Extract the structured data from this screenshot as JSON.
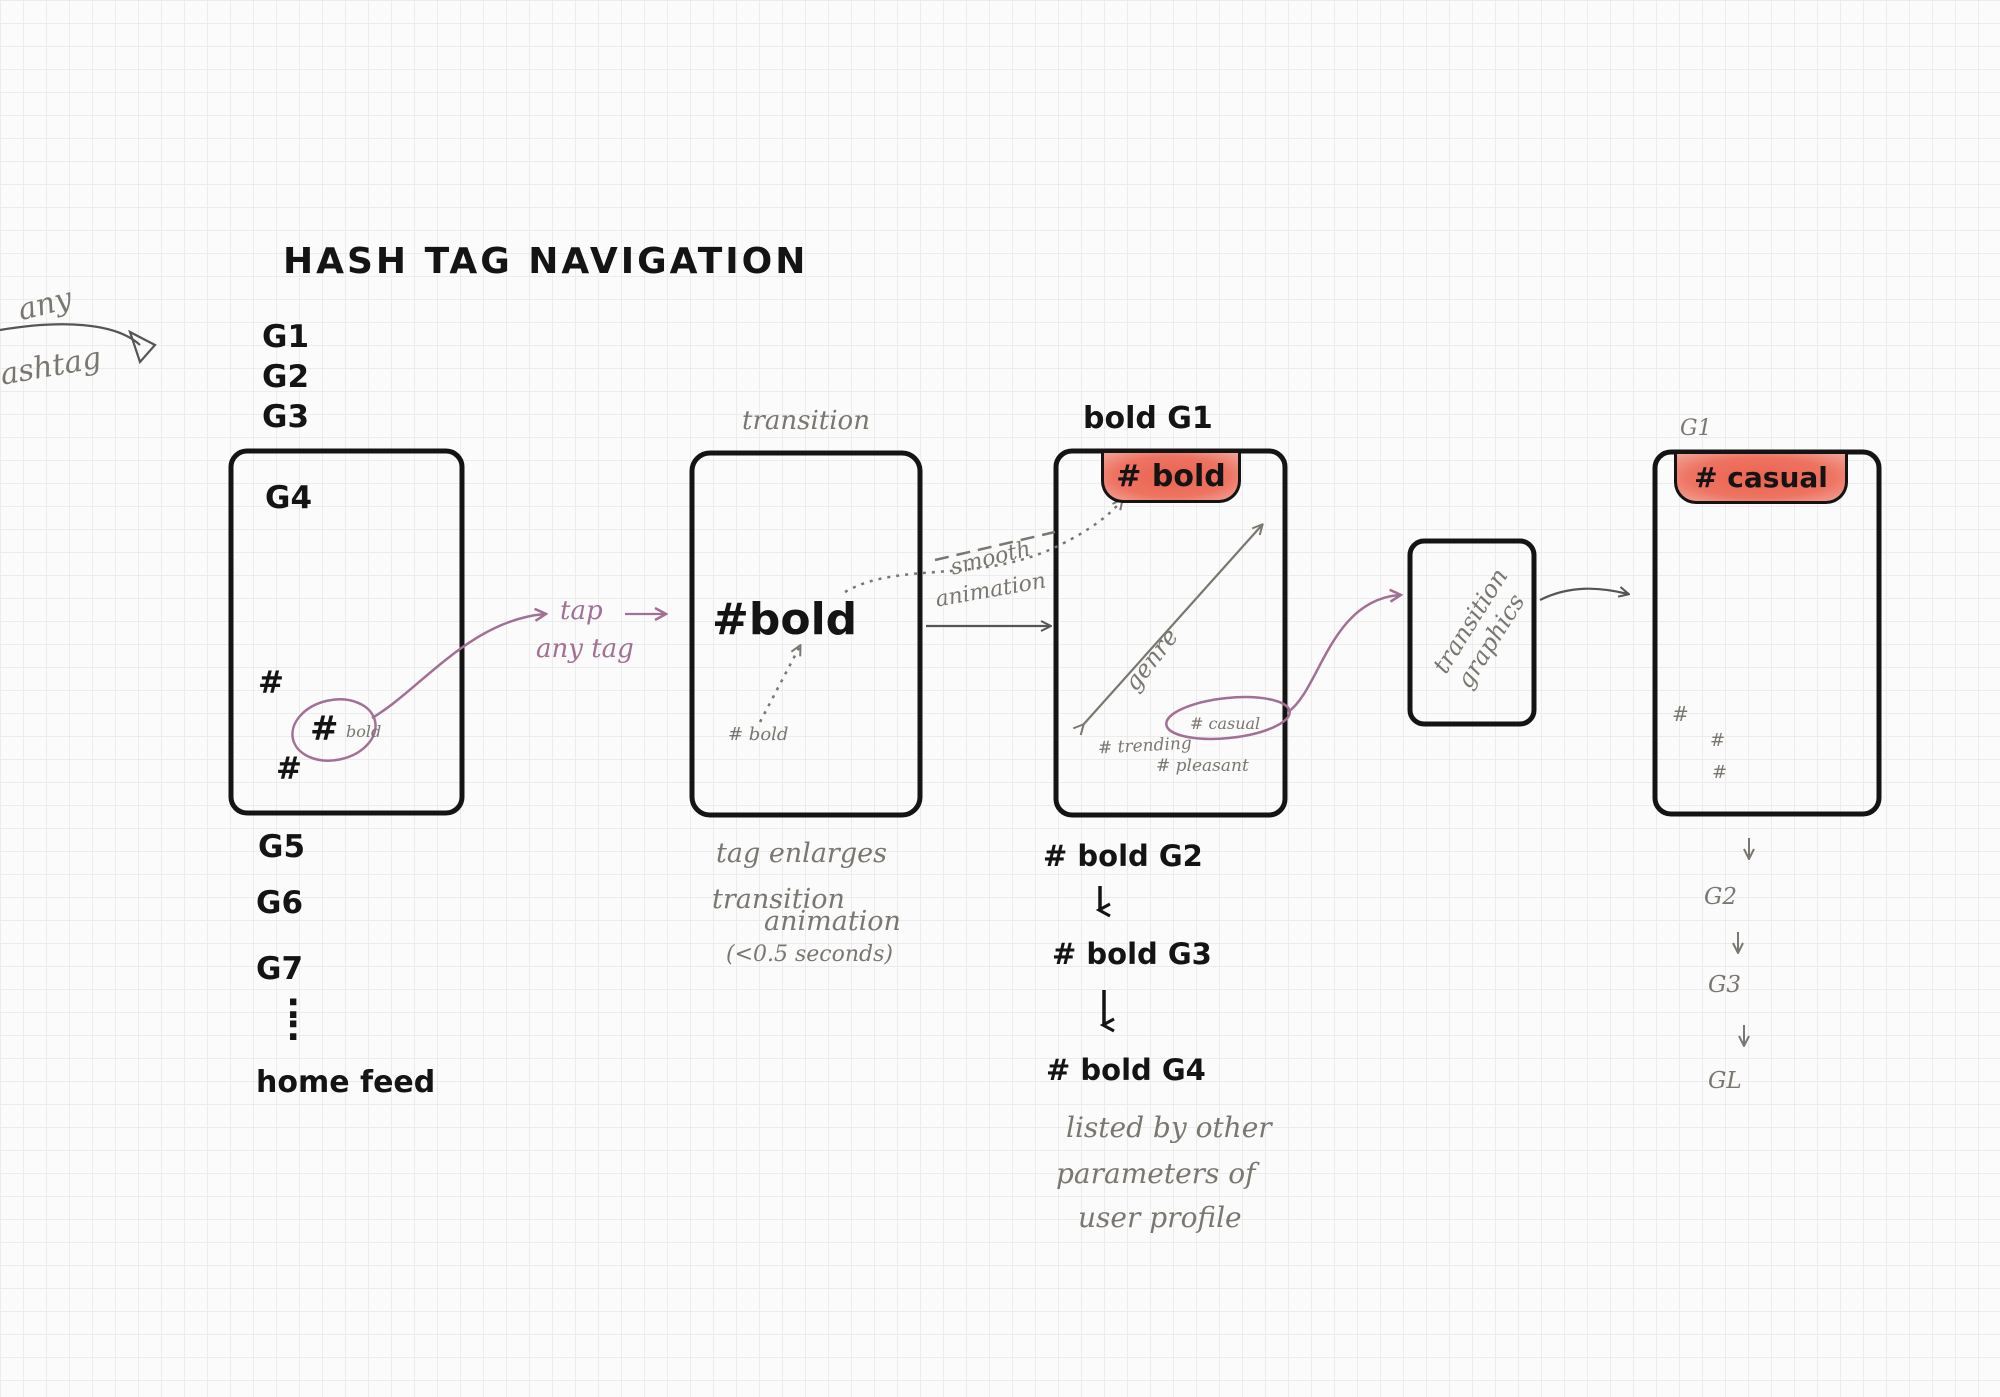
{
  "title": "HASH TAG   NAVIGATION",
  "left_note": {
    "line1": "any",
    "line2": "ashtag"
  },
  "screen1": {
    "above": [
      "G1",
      "G2",
      "G3"
    ],
    "inside_top": "G4",
    "hashes": [
      "#",
      "#",
      "#"
    ],
    "tag_word": "bold",
    "below": [
      "G5",
      "G6",
      "G7"
    ],
    "dots": ":",
    "footer": "home feed"
  },
  "tap_note": {
    "line1": "tap",
    "line2": "any tag"
  },
  "screen2": {
    "label": "transition",
    "big_tag": "#bold",
    "small_tag": "# bold",
    "caption": [
      "tag enlarges",
      "transition",
      "animation",
      "(<0.5 seconds)"
    ]
  },
  "smooth_note": {
    "line1": "smooth",
    "line2": "animation"
  },
  "screen3": {
    "label": "bold G1",
    "chip": "# bold",
    "diag_label": "genre",
    "tags": [
      "# casual",
      "# trending",
      "# pleasant"
    ],
    "list": [
      "# bold G2",
      "# bold G3",
      "#  bold G4"
    ],
    "note": [
      "listed by other",
      "parameters of",
      "user profile"
    ]
  },
  "screen4": {
    "label": "transition graphics"
  },
  "screen5": {
    "label": "G1",
    "chip": "# casual",
    "hashes": [
      "#",
      "#",
      "#"
    ],
    "list": [
      "G2",
      "G3",
      "GL"
    ]
  },
  "colors": {
    "ink": "#141414",
    "gray": "#7a7670",
    "purple": "#a07095",
    "chip": "#ee6e5c"
  }
}
